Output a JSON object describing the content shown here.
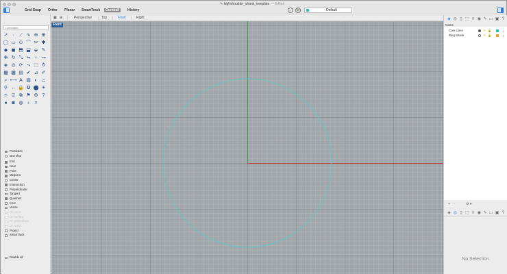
{
  "window": {
    "title_file": "highshoulder_shank_template",
    "title_status": "— Edited"
  },
  "toolbar": {
    "toggles": [
      {
        "label": "Grid Snap",
        "active": false
      },
      {
        "label": "Ortho",
        "active": false
      },
      {
        "label": "Planar",
        "active": false
      },
      {
        "label": "SmartTrack",
        "active": false
      },
      {
        "label": "Gumball",
        "active": true
      },
      {
        "label": "History",
        "active": false
      }
    ],
    "layer_selector": {
      "label": "Default",
      "swatch_color": "#22c3b3"
    }
  },
  "command": {
    "placeholder": "Command"
  },
  "viewports": {
    "tabs": [
      "Perspective",
      "Top",
      "Front",
      "Right"
    ],
    "active_tab": "Front",
    "active_label": "Front",
    "circle_color": "#5ec8c0",
    "x_axis_color": "#b04545",
    "y_axis_color": "#3f9a48"
  },
  "osnaps": {
    "mode_persistent": "Persistent",
    "mode_one_shot": "One shot",
    "items": [
      {
        "label": "End",
        "checked": true,
        "disabled": false
      },
      {
        "label": "Near",
        "checked": true,
        "disabled": false
      },
      {
        "label": "Point",
        "checked": true,
        "disabled": false
      },
      {
        "label": "Midpoint",
        "checked": true,
        "disabled": false
      },
      {
        "label": "Center",
        "checked": false,
        "disabled": false
      },
      {
        "label": "Intersection",
        "checked": true,
        "disabled": false
      },
      {
        "label": "Perpendicular",
        "checked": false,
        "disabled": false
      },
      {
        "label": "Tangent",
        "checked": false,
        "disabled": false
      },
      {
        "label": "Quadrant",
        "checked": true,
        "disabled": false
      },
      {
        "label": "Knot",
        "checked": false,
        "disabled": false
      },
      {
        "label": "Vertex",
        "checked": false,
        "disabled": false
      },
      {
        "label": "On curve",
        "checked": false,
        "disabled": true
      },
      {
        "label": "On surface",
        "checked": false,
        "disabled": true
      },
      {
        "label": "On polysurface",
        "checked": false,
        "disabled": true
      },
      {
        "label": "On mesh",
        "checked": false,
        "disabled": true
      },
      {
        "label": "Project",
        "checked": false,
        "disabled": false
      },
      {
        "label": "SmartTrack",
        "checked": false,
        "disabled": false
      }
    ],
    "disable_all": "Disable all"
  },
  "layers": {
    "header": "Name",
    "rows": [
      {
        "name": "Core Lines",
        "current": true,
        "color": "#22c3b3"
      },
      {
        "name": "Ring Shank",
        "current": false,
        "color": "#e8a020"
      }
    ],
    "add_label": "+",
    "remove_label": "−",
    "gear_label": "⚙ ▾"
  },
  "properties": {
    "empty_text": "No Selection"
  }
}
